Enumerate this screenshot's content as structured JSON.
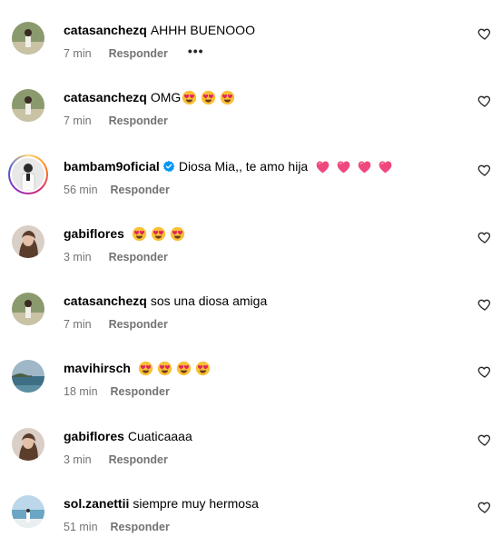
{
  "comments": [
    {
      "username": "catasanchezq",
      "verified": false,
      "text": "AHHH BUENOOO",
      "emoji_count": 0,
      "emoji": "",
      "time": "7 min",
      "reply_label": "Responder",
      "more_label": "•••",
      "avatar": "avatar-beach-girl",
      "story_ring": false
    },
    {
      "username": "catasanchezq",
      "verified": false,
      "text": "OMG",
      "emoji_count": 3,
      "emoji": "heart-eyes-emoji",
      "time": "7 min",
      "reply_label": "Responder",
      "avatar": "avatar-beach-girl",
      "story_ring": false
    },
    {
      "username": "bambam9oficial",
      "verified": true,
      "text": "Diosa Mia,, te amo hija",
      "emoji_count": 4,
      "emoji": "pink-heart-emoji",
      "time": "56 min",
      "reply_label": "Responder",
      "avatar": "avatar-man-white-shirt",
      "story_ring": true
    },
    {
      "username": "gabiflores",
      "verified": false,
      "text": "",
      "emoji_count": 3,
      "emoji": "heart-eyes-emoji",
      "time": "3 min",
      "reply_label": "Responder",
      "avatar": "avatar-woman-portrait",
      "story_ring": false
    },
    {
      "username": "catasanchezq",
      "verified": false,
      "text": "sos una diosa amiga",
      "emoji_count": 0,
      "emoji": "",
      "time": "7 min",
      "reply_label": "Responder",
      "avatar": "avatar-beach-girl",
      "story_ring": false
    },
    {
      "username": "mavihirsch",
      "verified": false,
      "text": "",
      "emoji_count": 4,
      "emoji": "heart-eyes-emoji",
      "time": "18 min",
      "reply_label": "Responder",
      "avatar": "avatar-sea-view",
      "story_ring": false
    },
    {
      "username": "gabiflores",
      "verified": false,
      "text": "Cuaticaaaa",
      "emoji_count": 0,
      "emoji": "",
      "time": "3 min",
      "reply_label": "Responder",
      "avatar": "avatar-woman-portrait",
      "story_ring": false
    },
    {
      "username": "sol.zanettii",
      "verified": false,
      "text": "siempre muy hermosa",
      "emoji_count": 0,
      "emoji": "",
      "time": "51 min",
      "reply_label": "Responder",
      "avatar": "avatar-coast",
      "story_ring": false
    }
  ],
  "colors": {
    "secondary_text": "#737373",
    "verified_blue": "#0095f6",
    "heart_outline": "#262626"
  }
}
